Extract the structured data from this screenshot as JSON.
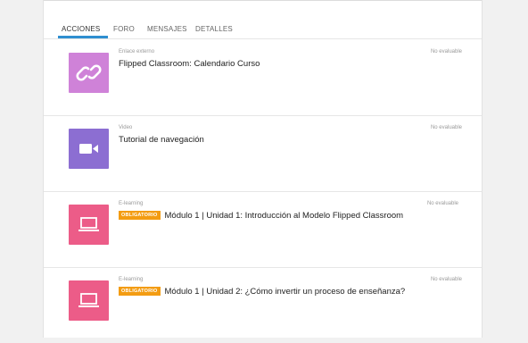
{
  "tabs": [
    {
      "label": "ACCIONES",
      "active": true
    },
    {
      "label": "FORO",
      "active": false
    },
    {
      "label": "MENSAJES",
      "active": false
    },
    {
      "label": "DETALLES",
      "active": false
    }
  ],
  "items": [
    {
      "type": "Enlace externo",
      "title": "Flipped Classroom: Calendario Curso",
      "status": "No evaluable",
      "badge": "",
      "icon": "link-icon",
      "color": "#cf82d8"
    },
    {
      "type": "Video",
      "title": "Tutorial de navegación",
      "status": "No evaluable",
      "badge": "",
      "icon": "video-camera-icon",
      "color": "#8c6ed2"
    },
    {
      "type": "E-learning",
      "title": "Módulo 1 | Unidad 1: Introducción al Modelo Flipped Classroom",
      "status": "No evaluable",
      "badge": "OBLIGATORIO",
      "icon": "laptop-icon",
      "color": "#ec5c88"
    },
    {
      "type": "E-learning",
      "title": "Módulo 1 | Unidad 2: ¿Cómo invertir un proceso de enseñanza?",
      "status": "No evaluable",
      "badge": "OBLIGATORIO",
      "icon": "laptop-icon",
      "color": "#ec5c88"
    }
  ],
  "colors": {
    "tab_underline": "#2f8fd0",
    "badge": "#f39c12"
  }
}
